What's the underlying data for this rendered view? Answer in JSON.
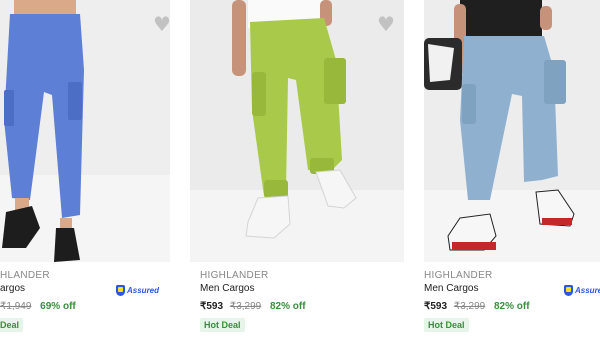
{
  "products": [
    {
      "brand": "HLANDER",
      "title": "argos",
      "price": "",
      "mrp": "₹1,949",
      "discount": "69% off",
      "deal": "Deal",
      "assured": "Assured",
      "wishlist_icon": "heart-icon",
      "pants_color": "#5d7fd6"
    },
    {
      "brand": "HIGHLANDER",
      "title": "Men Cargos",
      "price": "₹593",
      "mrp": "₹3,299",
      "discount": "82% off",
      "deal": "Hot Deal",
      "assured": "",
      "wishlist_icon": "heart-icon",
      "pants_color": "#a9c94a"
    },
    {
      "brand": "HIGHLANDER",
      "title": "Men Cargos",
      "price": "₹593",
      "mrp": "₹3,299",
      "discount": "82% off",
      "deal": "Hot Deal",
      "assured": "Assured",
      "wishlist_icon": "heart-icon",
      "pants_color": "#8fb1cf"
    }
  ],
  "colors": {
    "discount": "#388e3c",
    "assured": "#2a55e5",
    "image_bg": "#ececec"
  }
}
